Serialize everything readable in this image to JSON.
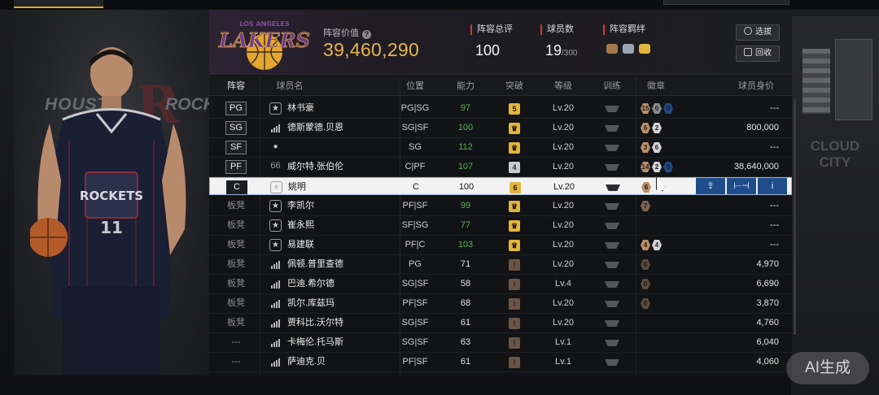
{
  "header": {
    "value_label": "阵容价值",
    "value": "39,460,290",
    "stats": [
      {
        "label": "阵容总评",
        "value": "100",
        "sub": ""
      },
      {
        "label": "球员数",
        "value": "19",
        "sub": "/300"
      },
      {
        "label": "阵容羁绊",
        "value": "",
        "sub": ""
      }
    ],
    "buttons": {
      "pick": "选拔",
      "recycle": "回收"
    },
    "logo_top_text": "LOS ANGELES",
    "logo_text": "LAKERS"
  },
  "background": {
    "team_left": "HOUSTO",
    "team_right": "ROCK",
    "wall_text": "CLOUD CITY"
  },
  "columns": {
    "lineup": "阵容",
    "name": "球员名",
    "position": "位置",
    "ability": "能力",
    "breakthrough": "突破",
    "level": "等级",
    "training": "训练",
    "badge": "徽章",
    "price": "球员身价"
  },
  "players": [
    {
      "slot": "PG",
      "starter": true,
      "icon": "star",
      "name": "林书豪",
      "pos": "PG|SG",
      "ability": "97",
      "ability_color": "#4db54d",
      "break": "5",
      "break_type": "gold-num",
      "level": "Lv.20",
      "badges": [
        "15",
        "0",
        "0"
      ],
      "badge_colors": [
        "#b98e6a",
        "#8b8b90",
        "#1f4a86"
      ],
      "price": "---"
    },
    {
      "slot": "SG",
      "starter": true,
      "icon": "bars",
      "name": "德斯蒙德.贝恩",
      "pos": "SG|SF",
      "ability": "100",
      "ability_color": "#4db54d",
      "break": "",
      "break_type": "gold-crown",
      "level": "Lv.20",
      "badges": [
        "6",
        "2"
      ],
      "badge_colors": [
        "#b98e6a",
        "#d4d4d8"
      ],
      "price": "800,000"
    },
    {
      "slot": "SF",
      "starter": true,
      "icon": "person",
      "name": "",
      "pos": "SG",
      "ability": "112",
      "ability_color": "#4db54d",
      "break": "",
      "break_type": "gold-crown",
      "level": "Lv.20",
      "badges": [
        "3",
        "6"
      ],
      "badge_colors": [
        "#b98e6a",
        "#d4d4d8"
      ],
      "price": "---"
    },
    {
      "slot": "PF",
      "starter": true,
      "icon": "66",
      "name": "威尔特.张伯伦",
      "pos": "C|PF",
      "ability": "107",
      "ability_color": "#4db54d",
      "break": "4",
      "break_type": "silver-num",
      "level": "Lv.20",
      "badges": [
        "14",
        "2",
        "0"
      ],
      "badge_colors": [
        "#b98e6a",
        "#d4d4d8",
        "#1f4a86"
      ],
      "price": "38,640,000"
    },
    {
      "slot": "C",
      "starter": true,
      "selected": true,
      "icon": "star",
      "name": "姚明",
      "pos": "C",
      "ability": "100",
      "ability_color": "#151515",
      "break": "6",
      "break_type": "gold-num",
      "level": "Lv.20",
      "badges": [
        "6"
      ],
      "badge_colors": [
        "#b98e6a"
      ],
      "price": ""
    },
    {
      "slot": "板凳",
      "starter": false,
      "icon": "star",
      "name": "李凯尔",
      "pos": "PF|SF",
      "ability": "99",
      "ability_color": "#4db54d",
      "break": "",
      "break_type": "gold-crown",
      "level": "Lv.20",
      "badges": [
        "7"
      ],
      "badge_colors": [
        "#7a6350"
      ],
      "price": "---"
    },
    {
      "slot": "板凳",
      "starter": false,
      "icon": "star",
      "name": "崔永熙",
      "pos": "SF|SG",
      "ability": "77",
      "ability_color": "#4db54d",
      "break": "",
      "break_type": "gold-crown",
      "level": "Lv.20",
      "badges": [],
      "badge_colors": [],
      "price": "---"
    },
    {
      "slot": "板凳",
      "starter": false,
      "icon": "star",
      "name": "易建联",
      "pos": "PF|C",
      "ability": "103",
      "ability_color": "#4db54d",
      "break": "",
      "break_type": "gold-crown",
      "level": "Lv.20",
      "badges": [
        "4",
        "4"
      ],
      "badge_colors": [
        "#b98e6a",
        "#d4d4d8"
      ],
      "price": "---"
    },
    {
      "slot": "板凳",
      "starter": false,
      "icon": "bars",
      "name": "佩顿.普里查德",
      "pos": "PG",
      "ability": "71",
      "ability_color": "#e4e4e4",
      "break": "",
      "break_type": "bronze",
      "level": "Lv.20",
      "badges": [
        "0"
      ],
      "badge_colors": [
        "#5a4a3e"
      ],
      "price": "4,970"
    },
    {
      "slot": "板凳",
      "starter": false,
      "icon": "bars",
      "name": "巴迪.希尔德",
      "pos": "SG|SF",
      "ability": "58",
      "ability_color": "#e4e4e4",
      "break": "",
      "break_type": "bronze",
      "level": "Lv.4",
      "badges": [
        "0"
      ],
      "badge_colors": [
        "#5a4a3e"
      ],
      "price": "6,690"
    },
    {
      "slot": "板凳",
      "starter": false,
      "icon": "bars",
      "name": "凯尔.库兹玛",
      "pos": "PF|SF",
      "ability": "68",
      "ability_color": "#e4e4e4",
      "break": "",
      "break_type": "bronze",
      "level": "Lv.20",
      "badges": [
        "0"
      ],
      "badge_colors": [
        "#5a4a3e"
      ],
      "price": "3,870"
    },
    {
      "slot": "板凳",
      "starter": false,
      "icon": "bars",
      "name": "贾科比.沃尔特",
      "pos": "SG|SF",
      "ability": "61",
      "ability_color": "#e4e4e4",
      "break": "",
      "break_type": "bronze",
      "level": "Lv.20",
      "badges": [],
      "badge_colors": [],
      "price": "4,760"
    },
    {
      "slot": "---",
      "starter": false,
      "icon": "bars",
      "name": "卡梅伦.托马斯",
      "pos": "SG|SF",
      "ability": "63",
      "ability_color": "#e4e4e4",
      "break": "",
      "break_type": "bronze",
      "level": "Lv.1",
      "badges": [],
      "badge_colors": [],
      "price": "6,040"
    },
    {
      "slot": "---",
      "starter": false,
      "icon": "bars",
      "name": "萨迪克.贝",
      "pos": "PF|SF",
      "ability": "61",
      "ability_color": "#e4e4e4",
      "break": "",
      "break_type": "bronze",
      "level": "Lv.1",
      "badges": [],
      "badge_colors": [],
      "price": "4,060"
    }
  ],
  "ai_badge": "AI生成",
  "jersey": {
    "text": "ROCKETS",
    "number": "11"
  }
}
